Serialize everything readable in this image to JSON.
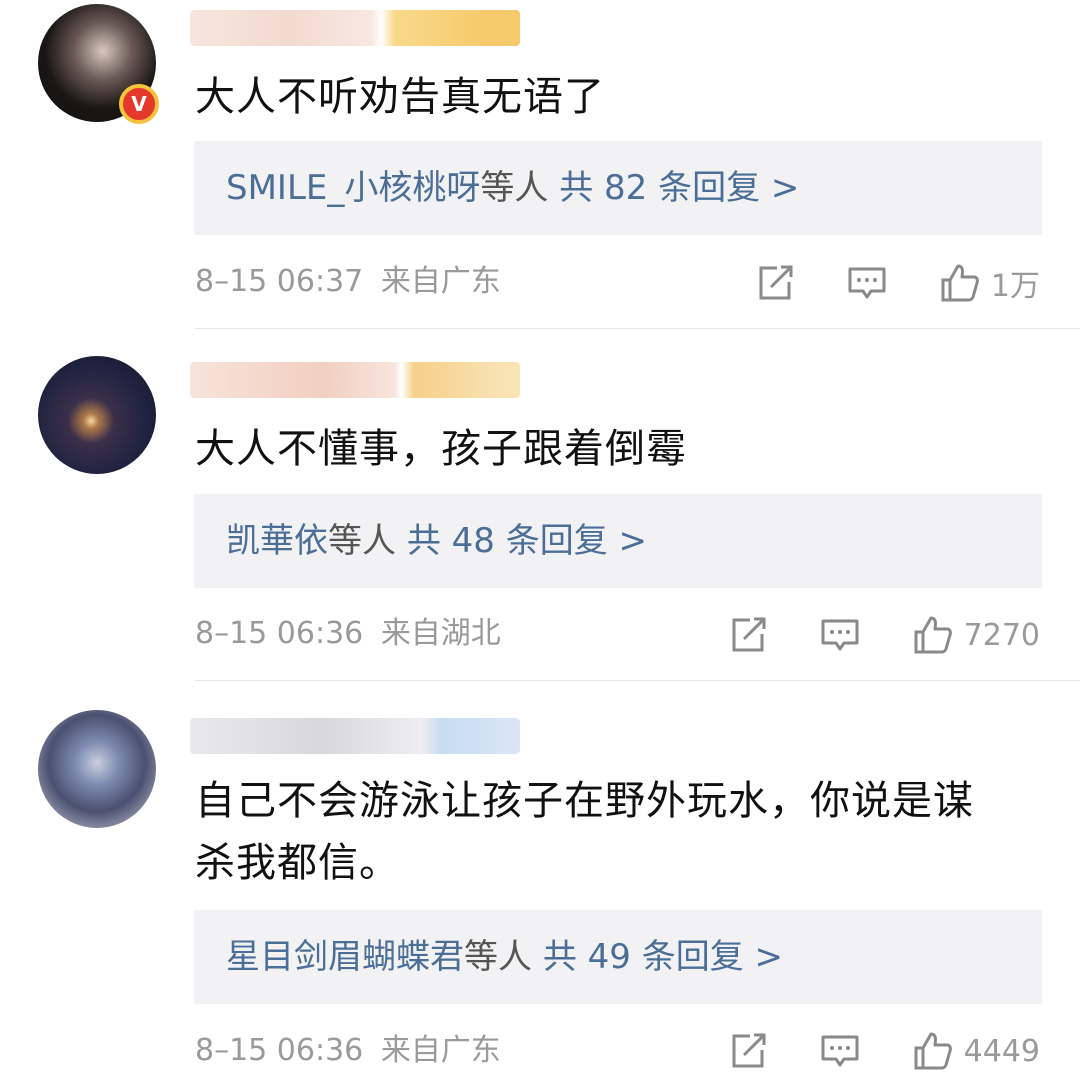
{
  "comments": [
    {
      "text": "大人不听劝告真无语了",
      "reply_names": "SMILE_小核桃呀",
      "reply_mid": "等人",
      "reply_count": "共 82 条回复 >",
      "time": "8–15 06:37",
      "location": "来自广东",
      "likes": "1万",
      "verified": "V"
    },
    {
      "text": "大人不懂事，孩子跟着倒霉",
      "reply_names": "凯華依",
      "reply_mid": "等人",
      "reply_count": "共 48 条回复 >",
      "time": "8–15 06:36",
      "location": "来自湖北",
      "likes": "7270"
    },
    {
      "text": "自己不会游泳让孩子在野外玩水，你说是谋杀我都信。",
      "reply_names": "星目剑眉蝴蝶君",
      "reply_mid": "等人",
      "reply_count": "共 49 条回复 >",
      "time": "8–15 06:36",
      "location": "来自广东",
      "likes": "4449"
    }
  ],
  "icons": {
    "share": "share-icon",
    "comment": "comment-icon",
    "like": "thumbs-up-icon"
  },
  "colors": {
    "link": "#4b6e97",
    "meta": "#9a9a9a",
    "reply_bg": "#f2f2f4"
  }
}
